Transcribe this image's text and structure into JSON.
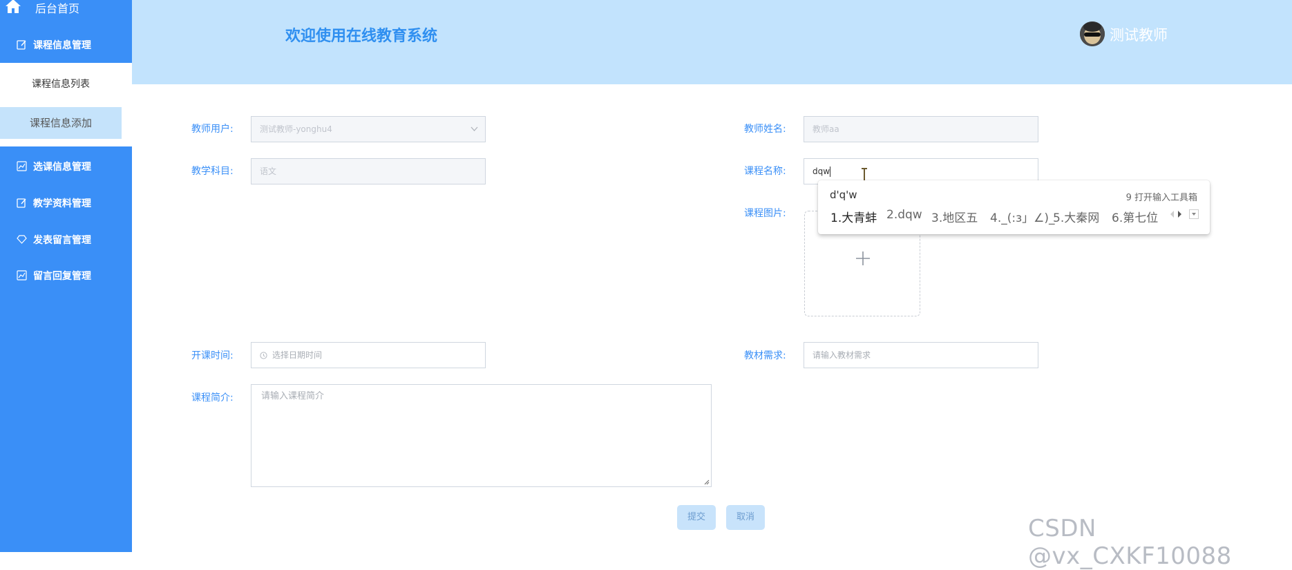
{
  "sidebar": {
    "home_label": "后台首页",
    "menus": [
      {
        "label": "课程信息管理",
        "icon": "edit-icon"
      },
      {
        "label": "选课信息管理",
        "icon": "chart-icon"
      },
      {
        "label": "教学资料管理",
        "icon": "edit-icon"
      },
      {
        "label": "发表留言管理",
        "icon": "diamond-icon"
      },
      {
        "label": "留言回复管理",
        "icon": "chart-icon"
      }
    ],
    "submenu": [
      "课程信息列表",
      "课程信息添加"
    ]
  },
  "header": {
    "title": "欢迎使用在线教育系统",
    "user_name": "测试教师"
  },
  "form": {
    "teacher_user": {
      "label": "教师用户:",
      "value": "测试教师-yonghu4"
    },
    "teacher_name": {
      "label": "教师姓名:",
      "value": "教师aa"
    },
    "subject": {
      "label": "教学科目:",
      "value": "语文"
    },
    "course_name": {
      "label": "课程名称:",
      "value": "dqw"
    },
    "course_image": {
      "label": "课程图片:"
    },
    "start_time": {
      "label": "开课时间:",
      "placeholder": "选择日期时间"
    },
    "textbook": {
      "label": "教材需求:",
      "placeholder": "请输入教材需求"
    },
    "intro": {
      "label": "课程简介:",
      "placeholder": "请输入课程简介"
    },
    "submit_label": "提交",
    "cancel_label": "取消"
  },
  "ime": {
    "composition": "d'q'w",
    "toolbox": "9 打开输入工具箱",
    "candidates": [
      "1.大青蚌",
      "2.dqw",
      "3.地区五",
      "4._(:з」∠)_",
      "5.大秦网",
      "6.第七位"
    ]
  },
  "watermark": "CSDN @vx_CXKF10088",
  "colors": {
    "sidebar": "#3a8ff7",
    "header": "#c2e3fd",
    "accent": "#2f8ff0"
  }
}
